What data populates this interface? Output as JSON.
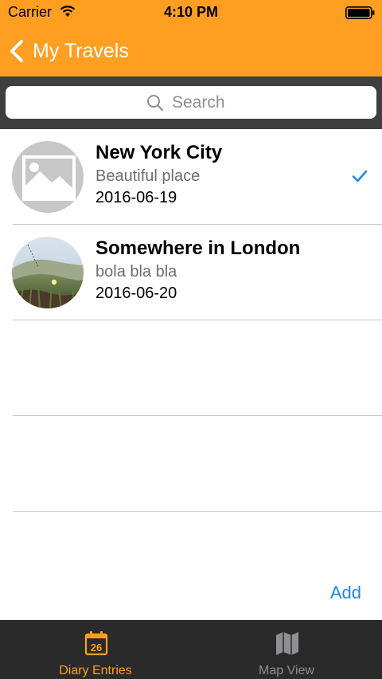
{
  "status_bar": {
    "carrier": "Carrier",
    "time": "4:10 PM",
    "wifi_icon": "wifi-icon",
    "battery_icon": "battery-icon"
  },
  "nav": {
    "back_label": "My Travels",
    "back_icon": "chevron-left-icon",
    "bar_color": "#FF9F22"
  },
  "search": {
    "placeholder": "Search",
    "value": "",
    "icon": "search-icon"
  },
  "entries": [
    {
      "title": "New York City",
      "subtitle": "Beautiful place",
      "date": "2016-06-19",
      "thumbnail": "placeholder-image-icon",
      "selected": true
    },
    {
      "title": "Somewhere in London",
      "subtitle": "bola bla bla",
      "date": "2016-06-20",
      "thumbnail": "landscape-photo",
      "selected": false
    }
  ],
  "actions": {
    "add_label": "Add"
  },
  "tabs": [
    {
      "label": "Diary Entries",
      "icon": "calendar-icon",
      "icon_text": "26",
      "active": true
    },
    {
      "label": "Map View",
      "icon": "map-icon",
      "active": false
    }
  ],
  "colors": {
    "accent": "#FF9F22",
    "link": "#1E88E5",
    "tab_bar": "#2A2A2A",
    "search_bar": "#3F3F3F"
  }
}
